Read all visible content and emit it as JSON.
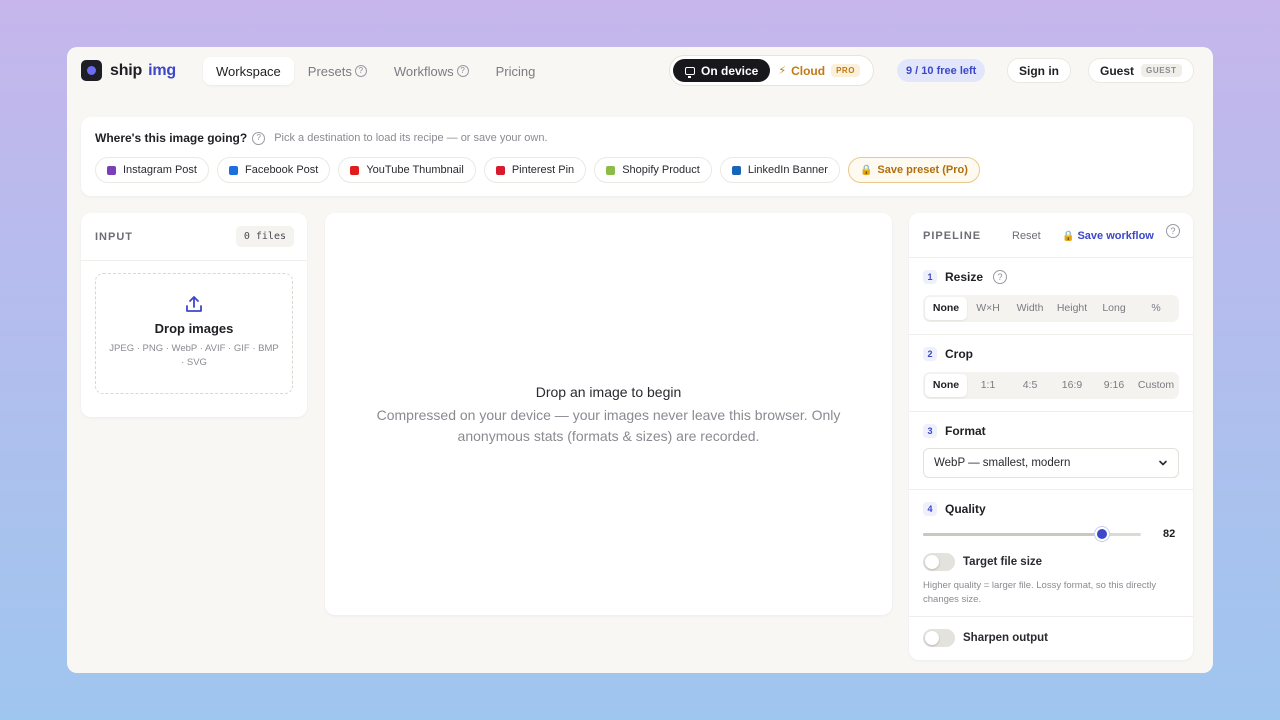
{
  "header": {
    "brand_first": "ship",
    "brand_second": "img",
    "nav": [
      {
        "label": "Workspace"
      },
      {
        "label": "Presets"
      },
      {
        "label": "Workflows"
      },
      {
        "label": "Pricing"
      }
    ],
    "mode": {
      "on_device": "On device",
      "cloud": "Cloud",
      "cloud_tag": "PRO"
    },
    "free_left": "9 / 10 free left",
    "sign_in": "Sign in",
    "guest_label": "Guest",
    "guest_tag": "GUEST"
  },
  "destination": {
    "title": "Where's this image going?",
    "subtitle": "Pick a destination to load its recipe — or save your own.",
    "chips": [
      {
        "label": "Instagram Post",
        "color": "#7b3fb8"
      },
      {
        "label": "Facebook Post",
        "color": "#1d6fe0"
      },
      {
        "label": "YouTube Thumbnail",
        "color": "#e21c1c"
      },
      {
        "label": "Pinterest Pin",
        "color": "#d81b2c"
      },
      {
        "label": "Shopify Product",
        "color": "#8dbb48"
      },
      {
        "label": "LinkedIn Banner",
        "color": "#1565b8"
      }
    ],
    "save_preset": "Save preset (Pro)"
  },
  "input": {
    "label": "INPUT",
    "files_count": "0 files",
    "drop_title": "Drop images",
    "formats": "JPEG · PNG · WebP · AVIF · GIF · BMP · SVG"
  },
  "canvas": {
    "title": "Drop an image to begin",
    "subtitle": "Compressed on your device — your images never leave this browser. Only anonymous stats (formats & sizes) are recorded."
  },
  "pipeline": {
    "label": "PIPELINE",
    "reset": "Reset",
    "save_workflow": "Save workflow",
    "resize": {
      "num": "1",
      "name": "Resize",
      "options": [
        "None",
        "W×H",
        "Width",
        "Height",
        "Long",
        "%"
      ],
      "selected": 0
    },
    "crop": {
      "num": "2",
      "name": "Crop",
      "options": [
        "None",
        "1:1",
        "4:5",
        "16:9",
        "9:16",
        "Custom"
      ],
      "selected": 0
    },
    "format": {
      "num": "3",
      "name": "Format",
      "value": "WebP — smallest, modern"
    },
    "quality": {
      "num": "4",
      "name": "Quality",
      "value": 82,
      "value_text": "82",
      "min": 0,
      "max": 100
    },
    "target_size": "Target file size",
    "hint": "Higher quality = larger file. Lossy format, so this directly changes size.",
    "sharpen": "Sharpen output"
  },
  "colors": {
    "accent": "#3d47c9",
    "pro": "#c07a12"
  }
}
